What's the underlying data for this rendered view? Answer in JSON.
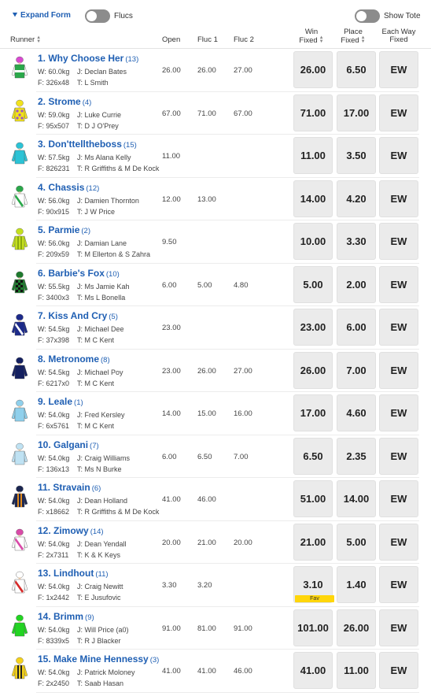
{
  "topbar": {
    "expand_label": "Expand Form",
    "flucs_label": "Flucs",
    "tote_label": "Show Tote"
  },
  "header": {
    "runner": "Runner",
    "open": "Open",
    "fluc1": "Fluc 1",
    "fluc2": "Fluc 2",
    "win_line1": "Win",
    "win_line2": "Fixed",
    "place_line1": "Place",
    "place_line2": "Fixed",
    "ew_line1": "Each Way",
    "ew_line2": "Fixed"
  },
  "fav_label": "Fav",
  "runners": [
    {
      "name": "1. Why Choose Her",
      "barrier": "(13)",
      "weight": "W: 60.0kg",
      "jockey": "J: Declan Bates",
      "form": "F: 326x48",
      "trainer": "T: L Smith",
      "open": "26.00",
      "fluc1": "26.00",
      "fluc2": "27.00",
      "win": "26.00",
      "place": "6.50",
      "ew": "EW",
      "fav": false,
      "silk": {
        "body": "#2aa84a",
        "sleeve": "#ffffff",
        "cap": "#d94ad1",
        "pattern": "band",
        "accent": "#ffffff"
      }
    },
    {
      "name": "2. Strome",
      "barrier": "(4)",
      "weight": "W: 59.0kg",
      "jockey": "J: Luke Currie",
      "form": "F: 95x507",
      "trainer": "T: D J O'Prey",
      "open": "67.00",
      "fluc1": "71.00",
      "fluc2": "67.00",
      "win": "71.00",
      "place": "17.00",
      "ew": "EW",
      "fav": false,
      "silk": {
        "body": "#f2e21b",
        "sleeve": "#f2e21b",
        "cap": "#f2e21b",
        "pattern": "spots",
        "accent": "#9a55c6"
      }
    },
    {
      "name": "3. Don'ttelltheboss",
      "barrier": "(15)",
      "weight": "W: 57.5kg",
      "jockey": "J: Ms Alana Kelly",
      "form": "F: 826231",
      "trainer": "T: R Griffiths & M De Kock",
      "open": "11.00",
      "fluc1": "",
      "fluc2": "",
      "win": "11.00",
      "place": "3.50",
      "ew": "EW",
      "fav": false,
      "silk": {
        "body": "#2bc3d6",
        "sleeve": "#2bc3d6",
        "cap": "#2bc3d6",
        "pattern": "plain",
        "accent": "#1a8fa0"
      }
    },
    {
      "name": "4. Chassis",
      "barrier": "(12)",
      "weight": "W: 56.0kg",
      "jockey": "J: Damien Thornton",
      "form": "F: 90x915",
      "trainer": "T: J W Price",
      "open": "12.00",
      "fluc1": "13.00",
      "fluc2": "",
      "win": "14.00",
      "place": "4.20",
      "ew": "EW",
      "fav": false,
      "silk": {
        "body": "#ffffff",
        "sleeve": "#ffffff",
        "cap": "#2aa84a",
        "pattern": "sash",
        "accent": "#2aa84a"
      }
    },
    {
      "name": "5. Parmie",
      "barrier": "(2)",
      "weight": "W: 56.0kg",
      "jockey": "J: Damian Lane",
      "form": "F: 209x59",
      "trainer": "T: M Ellerton & S Zahra",
      "open": "9.50",
      "fluc1": "",
      "fluc2": "",
      "win": "10.00",
      "place": "3.30",
      "ew": "EW",
      "fav": false,
      "silk": {
        "body": "#c4e01e",
        "sleeve": "#c4e01e",
        "cap": "#c4e01e",
        "pattern": "stripes",
        "accent": "#8aa80f"
      }
    },
    {
      "name": "6. Barbie's Fox",
      "barrier": "(10)",
      "weight": "W: 55.5kg",
      "jockey": "J: Ms Jamie Kah",
      "form": "F: 3400x3",
      "trainer": "T: Ms L Bonella",
      "open": "6.00",
      "fluc1": "5.00",
      "fluc2": "4.80",
      "win": "5.00",
      "place": "2.00",
      "ew": "EW",
      "fav": false,
      "silk": {
        "body": "#1e7a2e",
        "sleeve": "#1e7a2e",
        "cap": "#1e7a2e",
        "pattern": "checks",
        "accent": "#111111"
      }
    },
    {
      "name": "7. Kiss And Cry",
      "barrier": "(5)",
      "weight": "W: 54.5kg",
      "jockey": "J: Michael Dee",
      "form": "F: 37x398",
      "trainer": "T: M C Kent",
      "open": "23.00",
      "fluc1": "",
      "fluc2": "",
      "win": "23.00",
      "place": "6.00",
      "ew": "EW",
      "fav": false,
      "silk": {
        "body": "#1c2a8a",
        "sleeve": "#1c2a8a",
        "cap": "#1c2a8a",
        "pattern": "sash",
        "accent": "#ffffff"
      }
    },
    {
      "name": "8. Metronome",
      "barrier": "(8)",
      "weight": "W: 54.5kg",
      "jockey": "J: Michael Poy",
      "form": "F: 6217x0",
      "trainer": "T: M C Kent",
      "open": "23.00",
      "fluc1": "26.00",
      "fluc2": "27.00",
      "win": "26.00",
      "place": "7.00",
      "ew": "EW",
      "fav": false,
      "silk": {
        "body": "#142060",
        "sleeve": "#142060",
        "cap": "#142060",
        "pattern": "plain",
        "accent": "#ffffff"
      }
    },
    {
      "name": "9. Leale",
      "barrier": "(1)",
      "weight": "W: 54.0kg",
      "jockey": "J: Fred Kersley",
      "form": "F: 6x5761",
      "trainer": "T: M C Kent",
      "open": "14.00",
      "fluc1": "15.00",
      "fluc2": "16.00",
      "win": "17.00",
      "place": "4.60",
      "ew": "EW",
      "fav": false,
      "silk": {
        "body": "#8fd0ec",
        "sleeve": "#8fd0ec",
        "cap": "#8fd0ec",
        "pattern": "plain",
        "accent": "#5aa9cc"
      }
    },
    {
      "name": "10. Galgani",
      "barrier": "(7)",
      "weight": "W: 54.0kg",
      "jockey": "J: Craig Williams",
      "form": "F: 136x13",
      "trainer": "T: Ms N Burke",
      "open": "6.00",
      "fluc1": "6.50",
      "fluc2": "7.00",
      "win": "6.50",
      "place": "2.35",
      "ew": "EW",
      "fav": false,
      "silk": {
        "body": "#bfe2f3",
        "sleeve": "#bfe2f3",
        "cap": "#bfe2f3",
        "pattern": "plain",
        "accent": "#86bcd8"
      }
    },
    {
      "name": "11. Stravain",
      "barrier": "(6)",
      "weight": "W: 54.0kg",
      "jockey": "J: Dean Holland",
      "form": "F: x18662",
      "trainer": "T: R Griffiths & M De Kock",
      "open": "41.00",
      "fluc1": "46.00",
      "fluc2": "",
      "win": "51.00",
      "place": "14.00",
      "ew": "EW",
      "fav": false,
      "silk": {
        "body": "#1a2550",
        "sleeve": "#1a2550",
        "cap": "#1a2550",
        "pattern": "stripes",
        "accent": "#e0891a"
      }
    },
    {
      "name": "12. Zimowy",
      "barrier": "(14)",
      "weight": "W: 54.0kg",
      "jockey": "J: Dean Yendall",
      "form": "F: 2x7311",
      "trainer": "T: K & K Keys",
      "open": "20.00",
      "fluc1": "21.00",
      "fluc2": "20.00",
      "win": "21.00",
      "place": "5.00",
      "ew": "EW",
      "fav": false,
      "silk": {
        "body": "#ffffff",
        "sleeve": "#ffffff",
        "cap": "#d94aa8",
        "pattern": "sash",
        "accent": "#d94aa8"
      }
    },
    {
      "name": "13. Lindhout",
      "barrier": "(11)",
      "weight": "W: 54.0kg",
      "jockey": "J: Craig Newitt",
      "form": "F: 1x2442",
      "trainer": "T: E Jusufovic",
      "open": "3.30",
      "fluc1": "3.20",
      "fluc2": "",
      "win": "3.10",
      "place": "1.40",
      "ew": "EW",
      "fav": true,
      "silk": {
        "body": "#ffffff",
        "sleeve": "#ffffff",
        "cap": "#ffffff",
        "pattern": "sash",
        "accent": "#d62828"
      }
    },
    {
      "name": "14. Brimm",
      "barrier": "(9)",
      "weight": "W: 54.0kg",
      "jockey": "J: Will Price (a0)",
      "form": "F: 8339x5",
      "trainer": "T: R J Blacker",
      "open": "91.00",
      "fluc1": "81.00",
      "fluc2": "91.00",
      "win": "101.00",
      "place": "26.00",
      "ew": "EW",
      "fav": false,
      "silk": {
        "body": "#22d422",
        "sleeve": "#22d422",
        "cap": "#22d422",
        "pattern": "plain",
        "accent": "#18a018"
      }
    },
    {
      "name": "15. Make Mine Hennessy",
      "barrier": "(3)",
      "weight": "W: 54.0kg",
      "jockey": "J: Patrick Moloney",
      "form": "F: 2x2450",
      "trainer": "T: Saab Hasan",
      "open": "41.00",
      "fluc1": "41.00",
      "fluc2": "46.00",
      "win": "41.00",
      "place": "11.00",
      "ew": "EW",
      "fav": false,
      "silk": {
        "body": "#f5d21a",
        "sleeve": "#f5d21a",
        "cap": "#f5d21a",
        "pattern": "stripes",
        "accent": "#222222"
      }
    }
  ],
  "colors": {
    "link": "#1f5fb3",
    "button_bg": "#ebebeb",
    "fav": "#ffd60a",
    "toggle": "#8c8c8c"
  }
}
